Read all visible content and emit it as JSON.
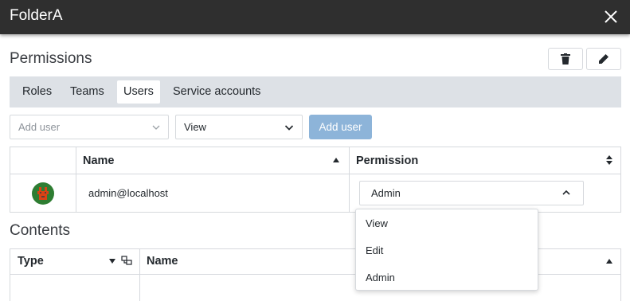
{
  "titlebar": {
    "title": "FolderA",
    "close_icon": "close-icon"
  },
  "permissions": {
    "heading": "Permissions",
    "delete_icon": "trash-icon",
    "edit_icon": "pencil-icon",
    "tabs": [
      {
        "label": "Roles",
        "active": false
      },
      {
        "label": "Teams",
        "active": false
      },
      {
        "label": "Users",
        "active": true
      },
      {
        "label": "Service accounts",
        "active": false
      }
    ],
    "add_user_placeholder": "Add user",
    "level_value": "View",
    "add_button": "Add user",
    "table": {
      "headers": {
        "name": "Name",
        "permission": "Permission"
      },
      "rows": [
        {
          "avatar": "user-avatar",
          "name": "admin@localhost",
          "permission": "Admin"
        }
      ]
    },
    "permission_options": [
      "View",
      "Edit",
      "Admin"
    ]
  },
  "contents": {
    "heading": "Contents",
    "headers": {
      "type": "Type",
      "name": "Name"
    }
  },
  "colors": {
    "titlebar_bg": "#2f2f2f",
    "tabbar_bg": "#dde1e6",
    "primary_disabled": "#8db4d9",
    "border": "#d6d9dd",
    "avatar_bg": "#2e7d32",
    "avatar_fg": "#d84315"
  }
}
